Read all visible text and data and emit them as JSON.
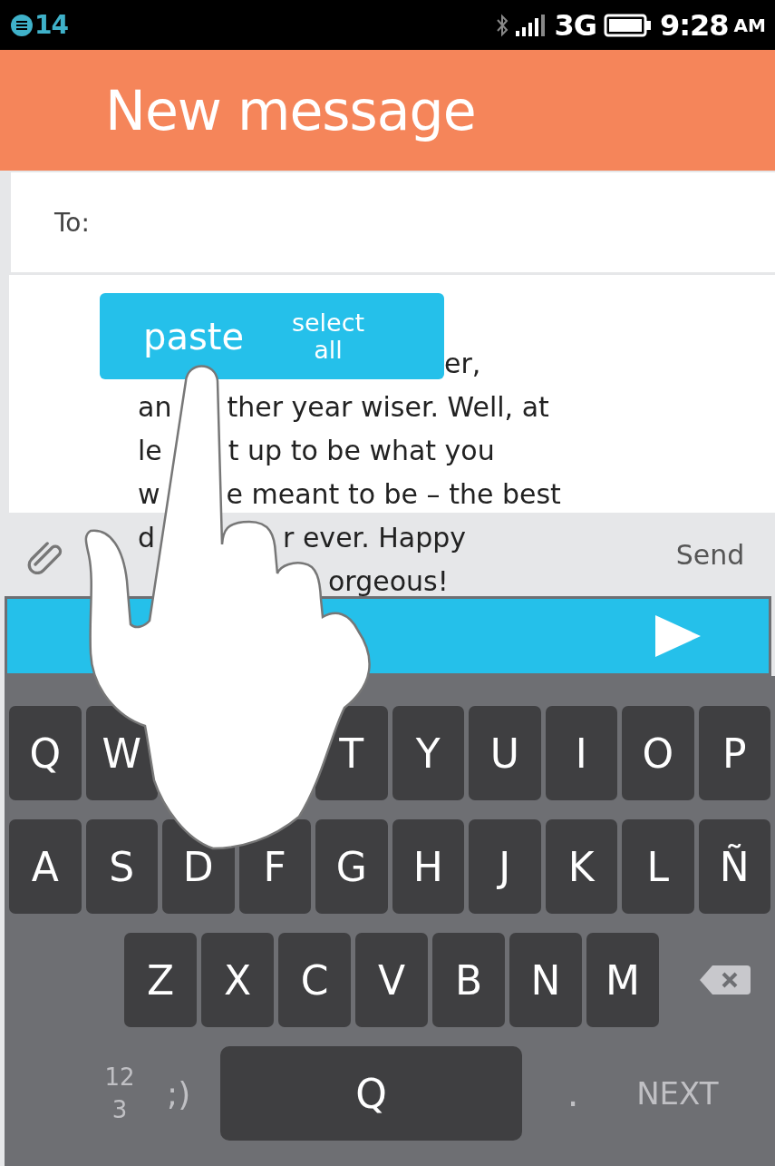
{
  "status_bar": {
    "notification_count": "14",
    "network": "3G",
    "time": "9:28",
    "ampm": "AM"
  },
  "header": {
    "title": "New message"
  },
  "to_field": {
    "label": "To:"
  },
  "selection_menu": [
    {
      "label": "paste",
      "kind": "large"
    },
    {
      "label": "select all",
      "kind": "small"
    }
  ],
  "message_lines": [
    {
      "parts": [
        "er,"
      ]
    },
    {
      "parts": [
        "an",
        "ther year wiser. Well, at"
      ]
    },
    {
      "parts": [
        "le",
        "t up to be what you"
      ]
    },
    {
      "parts": [
        "w",
        "e meant to be – the best"
      ]
    },
    {
      "parts": [
        "d",
        "r ever. Happy"
      ]
    },
    {
      "parts": [
        "orgeous!"
      ]
    }
  ],
  "compose": {
    "send": "Send"
  },
  "keyboard": {
    "rows": [
      [
        {
          "label": "Q"
        },
        {
          "label": "W"
        },
        {
          "kind": "covered"
        },
        {
          "kind": "covered"
        },
        {
          "label": "T"
        },
        {
          "label": "Y"
        },
        {
          "label": "U"
        },
        {
          "label": "I"
        },
        {
          "label": "O"
        },
        {
          "label": "P"
        }
      ],
      [
        {
          "label": "A"
        },
        {
          "label": "S"
        },
        {
          "label": "D"
        },
        {
          "label": "F"
        },
        {
          "label": "G"
        },
        {
          "label": "H"
        },
        {
          "label": "J"
        },
        {
          "label": "K"
        },
        {
          "label": "L"
        },
        {
          "label": "Ñ"
        }
      ],
      [
        {
          "label": "Z"
        },
        {
          "label": "X"
        },
        {
          "label": "C"
        },
        {
          "label": "V"
        },
        {
          "label": "B"
        },
        {
          "label": "N"
        },
        {
          "label": "M"
        }
      ]
    ],
    "numbers": "123",
    "emoji": ";)",
    "space": "Q",
    "period": ".",
    "next": "NEXT"
  }
}
